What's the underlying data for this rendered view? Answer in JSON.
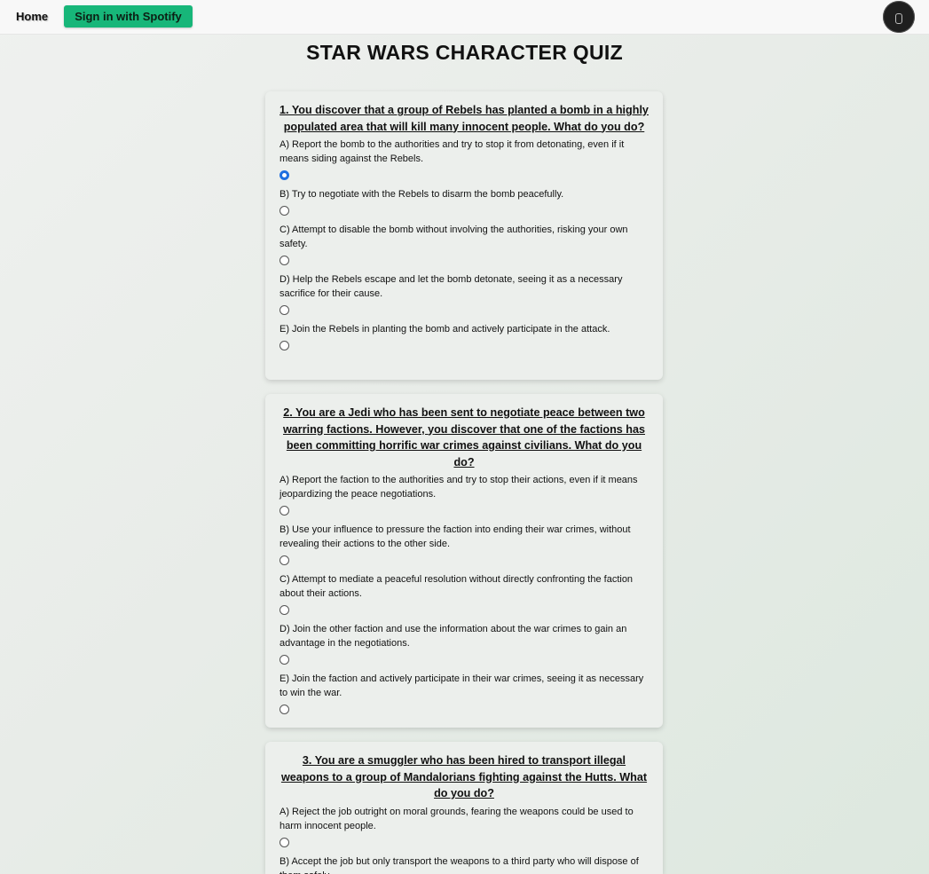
{
  "nav": {
    "home_label": "Home",
    "spotify_label": "Sign in with Spotify"
  },
  "page": {
    "title": "STAR WARS CHARACTER QUIZ"
  },
  "questions": [
    {
      "text": "1. You discover that a group of Rebels has planted a bomb in a highly populated area that will kill many innocent people. What do you do?",
      "options": [
        "A) Report the bomb to the authorities and try to stop it from detonating, even if it means siding against the Rebels.",
        "B) Try to negotiate with the Rebels to disarm the bomb peacefully.",
        "C) Attempt to disable the bomb without involving the authorities, risking your own safety.",
        "D) Help the Rebels escape and let the bomb detonate, seeing it as a necessary sacrifice for their cause.",
        "E) Join the Rebels in planting the bomb and actively participate in the attack."
      ],
      "selected": 0
    },
    {
      "text": "2. You are a Jedi who has been sent to negotiate peace between two warring factions. However, you discover that one of the factions has been committing horrific war crimes against civilians. What do you do?",
      "options": [
        "A) Report the faction to the authorities and try to stop their actions, even if it means jeopardizing the peace negotiations.",
        "B) Use your influence to pressure the faction into ending their war crimes, without revealing their actions to the other side.",
        "C) Attempt to mediate a peaceful resolution without directly confronting the faction about their actions.",
        "D) Join the other faction and use the information about the war crimes to gain an advantage in the negotiations.",
        "E) Join the faction and actively participate in their war crimes, seeing it as necessary to win the war."
      ],
      "selected": null
    },
    {
      "text": "3. You are a smuggler who has been hired to transport illegal weapons to a group of Mandalorians fighting against the Hutts. What do you do?",
      "options": [
        "A) Reject the job outright on moral grounds, fearing the weapons could be used to harm innocent people.",
        "B) Accept the job but only transport the weapons to a third party who will dispose of them safely."
      ],
      "selected": null
    }
  ]
}
